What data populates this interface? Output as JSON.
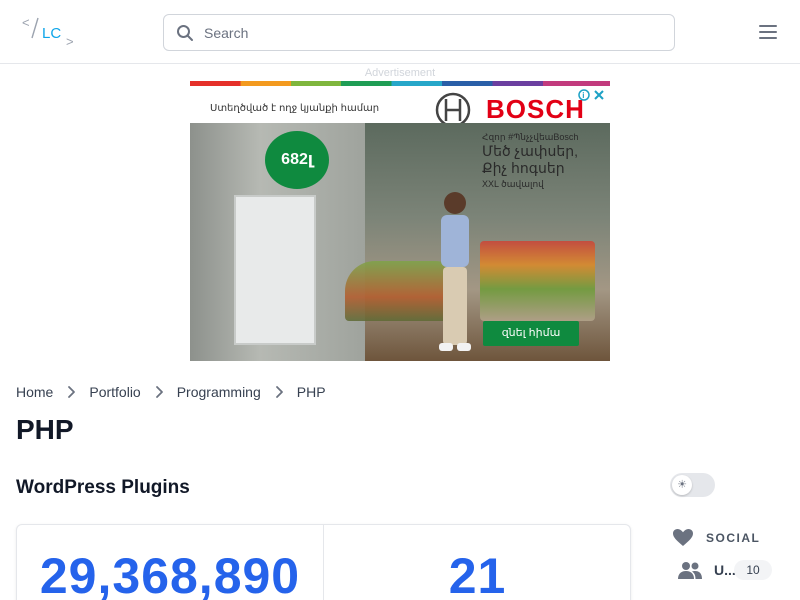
{
  "header": {
    "logo_text": "</LC>",
    "search_placeholder": "Search"
  },
  "ad": {
    "label": "Advertisement",
    "tagline": "Ստեղծված է ողջ կյանքի համար",
    "brand": "BOSCH",
    "badge": "682լ",
    "hashtag": "Հզոր #ՊնչչվեաBosch",
    "headline_1": "Մեծ չափսեր,",
    "headline_2": "Քիչ հոգսեր",
    "subline": "XXL ծավալով",
    "cta": "զնել հիմա"
  },
  "breadcrumb": {
    "items": [
      "Home",
      "Portfolio",
      "Programming",
      "PHP"
    ]
  },
  "page": {
    "title": "PHP",
    "section_title": "WordPress Plugins"
  },
  "theme_toggle": {
    "icon": "sun-icon",
    "state": "light"
  },
  "stats": {
    "downloads": "29,368,890",
    "plugins": "21"
  },
  "sidebar": {
    "social_label": "SOCIAL",
    "social_row_label": "U...",
    "social_row_count": "10"
  },
  "colors": {
    "accent": "#2563eb",
    "logo_blue": "#0ea5e9",
    "bosch_red": "#e20015",
    "ad_green": "#0f8a3f"
  }
}
